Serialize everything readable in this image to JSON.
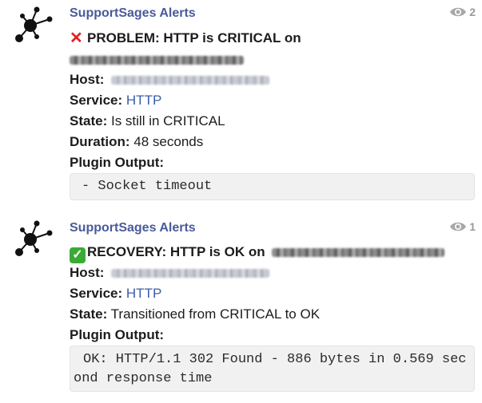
{
  "messages": [
    {
      "author": "SupportSages Alerts",
      "seen_count": "2",
      "headline": "PROBLEM: HTTP is CRITICAL on",
      "host_label": "Host:",
      "service_label": "Service:",
      "service_value": "HTTP",
      "state_label": "State:",
      "state_value": "Is still in CRITICAL",
      "duration_label": "Duration:",
      "duration_value": "48 seconds",
      "output_label": "Plugin Output:",
      "output_text": "- Socket timeout",
      "status_icon": "cross-mark-icon"
    },
    {
      "author": "SupportSages Alerts",
      "seen_count": "1",
      "headline": "RECOVERY: HTTP is OK on",
      "host_label": "Host:",
      "service_label": "Service:",
      "service_value": "HTTP",
      "state_label": "State:",
      "state_value": "Transitioned from CRITICAL to OK",
      "output_label": "Plugin Output:",
      "output_text": "OK: HTTP/1.1 302 Found - 886 bytes in 0.569 second response time",
      "status_icon": "check-mark-icon"
    }
  ],
  "colors": {
    "author": "#4a5a9a",
    "link": "#3d5caa",
    "code_bg": "#f1f1f1"
  }
}
